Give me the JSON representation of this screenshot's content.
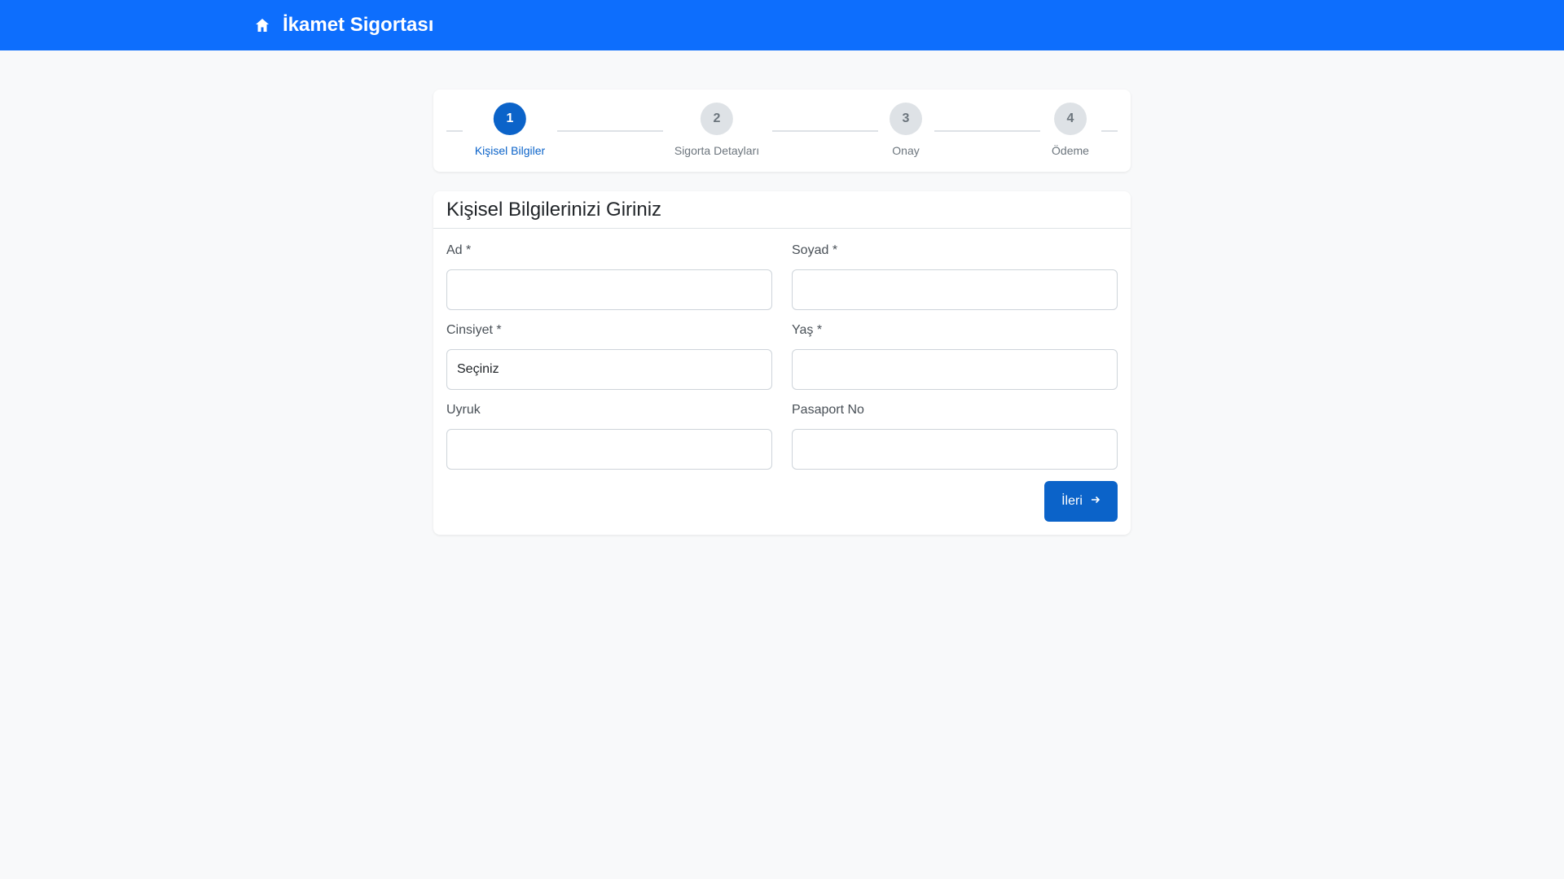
{
  "navbar": {
    "title": "İkamet Sigortası",
    "icon": "home-icon",
    "color": "#0d6efd"
  },
  "stepper": {
    "steps": [
      {
        "number": "1",
        "label": "Kişisel Bilgiler",
        "active": true
      },
      {
        "number": "2",
        "label": "Sigorta Detayları",
        "active": false
      },
      {
        "number": "3",
        "label": "Onay",
        "active": false
      },
      {
        "number": "4",
        "label": "Ödeme",
        "active": false
      }
    ]
  },
  "form": {
    "title": "Kişisel Bilgilerinizi Giriniz",
    "fields": {
      "first_name": {
        "label": "Ad *",
        "value": ""
      },
      "last_name": {
        "label": "Soyad *",
        "value": ""
      },
      "gender": {
        "label": "Cinsiyet *",
        "value": "Seçiniz"
      },
      "age": {
        "label": "Yaş *",
        "value": ""
      },
      "nationality": {
        "label": "Uyruk",
        "value": ""
      },
      "passport": {
        "label": "Pasaport No",
        "value": ""
      }
    },
    "next_label": "İleri",
    "next_icon": "arrow-right-icon"
  },
  "colors": {
    "primary": "#0b63c9",
    "inactive_step": "#dee2e6",
    "background": "#f8f9fa"
  }
}
